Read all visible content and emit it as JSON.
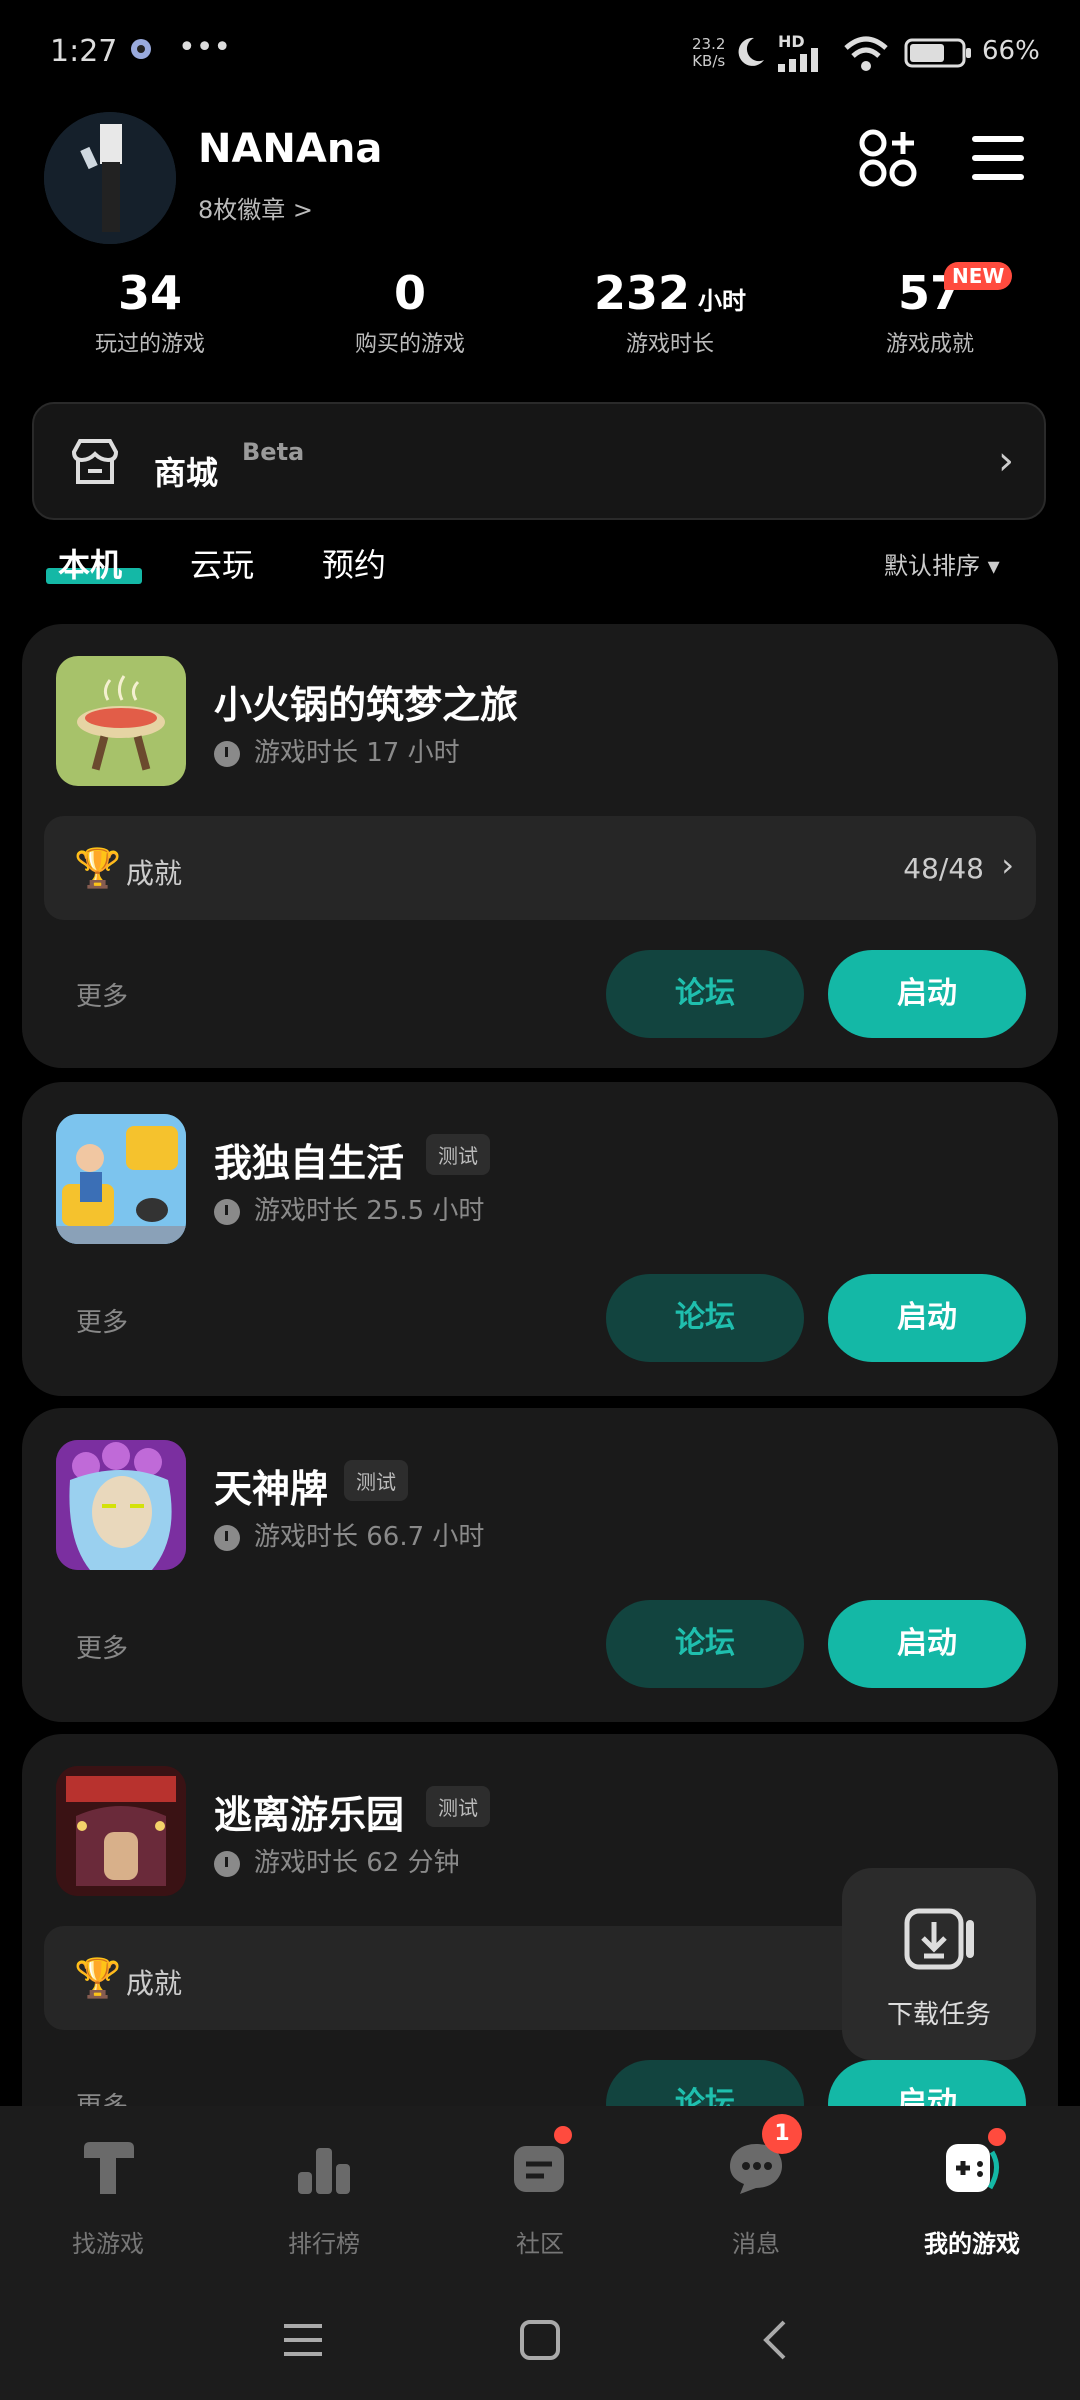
{
  "status_bar": {
    "time": "1:27",
    "more": "•••",
    "net_speed": "23.2",
    "net_unit": "KB/s",
    "hd": "HD",
    "battery": "66%"
  },
  "profile": {
    "username": "NANAna",
    "badges": "8枚徽章 >"
  },
  "stats": [
    {
      "value": "34",
      "unit": "",
      "label": "玩过的游戏"
    },
    {
      "value": "0",
      "unit": "",
      "label": "购买的游戏"
    },
    {
      "value": "232",
      "unit": "小时",
      "label": "游戏时长"
    },
    {
      "value": "57",
      "unit": "",
      "label": "游戏成就"
    }
  ],
  "new_badge": "NEW",
  "store": {
    "label": "商城",
    "beta": "Beta"
  },
  "tabs": [
    {
      "label": "本机",
      "active": true
    },
    {
      "label": "云玩",
      "active": false
    },
    {
      "label": "预约",
      "active": false
    }
  ],
  "sort": "默认排序 ▾",
  "games": [
    {
      "title": "小火锅的筑梦之旅",
      "tag": "",
      "playtime": "游戏时长 17 小时",
      "achievement_label": "成就",
      "achievement_count": "48/48"
    },
    {
      "title": "我独自生活",
      "tag": "测试",
      "playtime": "游戏时长 25.5 小时"
    },
    {
      "title": "天神牌",
      "tag": "测试",
      "playtime": "游戏时长 66.7 小时"
    },
    {
      "title": "逃离游乐园",
      "tag": "测试",
      "playtime": "游戏时长 62 分钟",
      "achievement_label": "成就"
    }
  ],
  "card_actions": {
    "more": "更多",
    "forum": "论坛",
    "launch": "启动"
  },
  "download_task": "下载任务",
  "bottom_nav": [
    {
      "label": "找游戏",
      "icon": "find-game-icon"
    },
    {
      "label": "排行榜",
      "icon": "ranking-icon"
    },
    {
      "label": "社区",
      "icon": "community-icon"
    },
    {
      "label": "消息",
      "icon": "message-icon",
      "badge": "1"
    },
    {
      "label": "我的游戏",
      "icon": "my-games-icon",
      "active": true
    }
  ],
  "colors": {
    "accent": "#14b8a6",
    "forum_bg": "#12443f",
    "badge_red": "#ff4b3e",
    "card_bg": "#1a1a1a"
  }
}
